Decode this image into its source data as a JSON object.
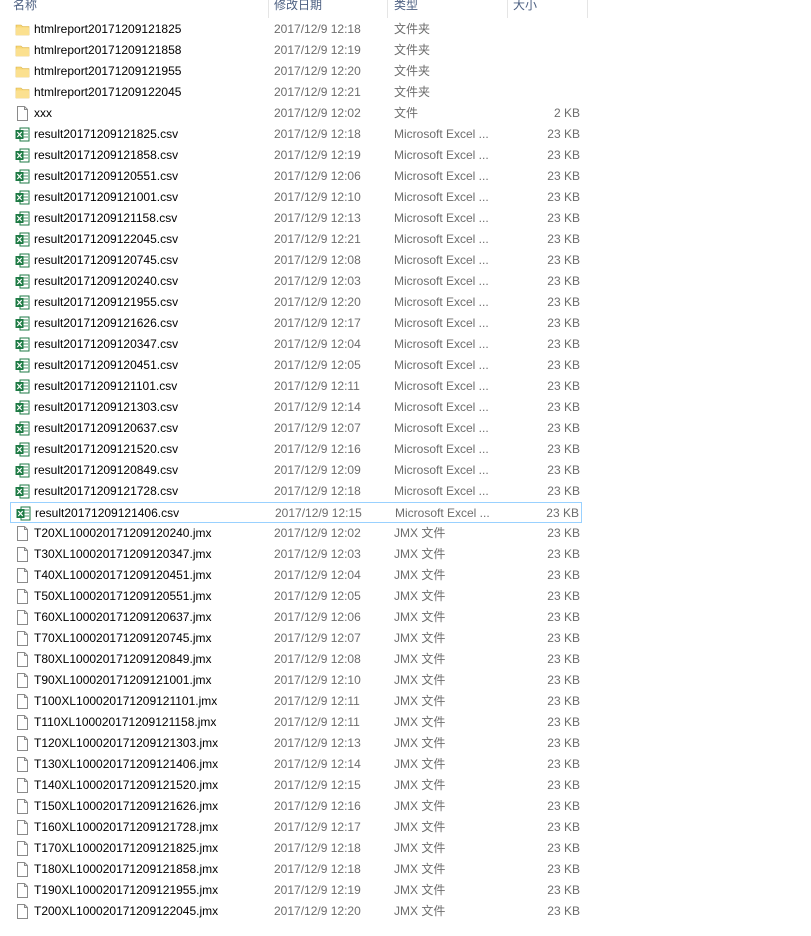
{
  "columns": {
    "name": "名称",
    "date": "修改日期",
    "type": "类型",
    "size": "大小"
  },
  "icon_colors": {
    "folder": "#f8d775",
    "excel": "#1d7a44",
    "file": "#ffffff"
  },
  "files": [
    {
      "icon": "folder-icon",
      "name": "htmlreport20171209121825",
      "date": "2017/12/9 12:18",
      "type": "文件夹",
      "size": ""
    },
    {
      "icon": "folder-icon",
      "name": "htmlreport20171209121858",
      "date": "2017/12/9 12:19",
      "type": "文件夹",
      "size": ""
    },
    {
      "icon": "folder-icon",
      "name": "htmlreport20171209121955",
      "date": "2017/12/9 12:20",
      "type": "文件夹",
      "size": ""
    },
    {
      "icon": "folder-icon",
      "name": "htmlreport20171209122045",
      "date": "2017/12/9 12:21",
      "type": "文件夹",
      "size": ""
    },
    {
      "icon": "file-icon",
      "name": "xxx",
      "date": "2017/12/9 12:02",
      "type": "文件",
      "size": "2 KB"
    },
    {
      "icon": "excel-icon",
      "name": "result20171209121825.csv",
      "date": "2017/12/9 12:18",
      "type": "Microsoft Excel ...",
      "size": "23 KB"
    },
    {
      "icon": "excel-icon",
      "name": "result20171209121858.csv",
      "date": "2017/12/9 12:19",
      "type": "Microsoft Excel ...",
      "size": "23 KB"
    },
    {
      "icon": "excel-icon",
      "name": "result20171209120551.csv",
      "date": "2017/12/9 12:06",
      "type": "Microsoft Excel ...",
      "size": "23 KB"
    },
    {
      "icon": "excel-icon",
      "name": "result20171209121001.csv",
      "date": "2017/12/9 12:10",
      "type": "Microsoft Excel ...",
      "size": "23 KB"
    },
    {
      "icon": "excel-icon",
      "name": "result20171209121158.csv",
      "date": "2017/12/9 12:13",
      "type": "Microsoft Excel ...",
      "size": "23 KB"
    },
    {
      "icon": "excel-icon",
      "name": "result20171209122045.csv",
      "date": "2017/12/9 12:21",
      "type": "Microsoft Excel ...",
      "size": "23 KB"
    },
    {
      "icon": "excel-icon",
      "name": "result20171209120745.csv",
      "date": "2017/12/9 12:08",
      "type": "Microsoft Excel ...",
      "size": "23 KB"
    },
    {
      "icon": "excel-icon",
      "name": "result20171209120240.csv",
      "date": "2017/12/9 12:03",
      "type": "Microsoft Excel ...",
      "size": "23 KB"
    },
    {
      "icon": "excel-icon",
      "name": "result20171209121955.csv",
      "date": "2017/12/9 12:20",
      "type": "Microsoft Excel ...",
      "size": "23 KB"
    },
    {
      "icon": "excel-icon",
      "name": "result20171209121626.csv",
      "date": "2017/12/9 12:17",
      "type": "Microsoft Excel ...",
      "size": "23 KB"
    },
    {
      "icon": "excel-icon",
      "name": "result20171209120347.csv",
      "date": "2017/12/9 12:04",
      "type": "Microsoft Excel ...",
      "size": "23 KB"
    },
    {
      "icon": "excel-icon",
      "name": "result20171209120451.csv",
      "date": "2017/12/9 12:05",
      "type": "Microsoft Excel ...",
      "size": "23 KB"
    },
    {
      "icon": "excel-icon",
      "name": "result20171209121101.csv",
      "date": "2017/12/9 12:11",
      "type": "Microsoft Excel ...",
      "size": "23 KB"
    },
    {
      "icon": "excel-icon",
      "name": "result20171209121303.csv",
      "date": "2017/12/9 12:14",
      "type": "Microsoft Excel ...",
      "size": "23 KB"
    },
    {
      "icon": "excel-icon",
      "name": "result20171209120637.csv",
      "date": "2017/12/9 12:07",
      "type": "Microsoft Excel ...",
      "size": "23 KB"
    },
    {
      "icon": "excel-icon",
      "name": "result20171209121520.csv",
      "date": "2017/12/9 12:16",
      "type": "Microsoft Excel ...",
      "size": "23 KB"
    },
    {
      "icon": "excel-icon",
      "name": "result20171209120849.csv",
      "date": "2017/12/9 12:09",
      "type": "Microsoft Excel ...",
      "size": "23 KB"
    },
    {
      "icon": "excel-icon",
      "name": "result20171209121728.csv",
      "date": "2017/12/9 12:18",
      "type": "Microsoft Excel ...",
      "size": "23 KB"
    },
    {
      "icon": "excel-icon",
      "name": "result20171209121406.csv",
      "date": "2017/12/9 12:15",
      "type": "Microsoft Excel ...",
      "size": "23 KB",
      "selected": true
    },
    {
      "icon": "file-icon",
      "name": "T20XL10002017120912 0240.jmx",
      "date": "2017/12/9 12:02",
      "type": "JMX 文件",
      "size": "23 KB"
    },
    {
      "icon": "file-icon",
      "name": "T30XL100020171209120347.jmx",
      "date": "2017/12/9 12:03",
      "type": "JMX 文件",
      "size": "23 KB"
    },
    {
      "icon": "file-icon",
      "name": "T40XL100020171209120451.jmx",
      "date": "2017/12/9 12:04",
      "type": "JMX 文件",
      "size": "23 KB"
    },
    {
      "icon": "file-icon",
      "name": "T50XL100020171209120551.jmx",
      "date": "2017/12/9 12:05",
      "type": "JMX 文件",
      "size": "23 KB"
    },
    {
      "icon": "file-icon",
      "name": "T60XL100020171209120637.jmx",
      "date": "2017/12/9 12:06",
      "type": "JMX 文件",
      "size": "23 KB"
    },
    {
      "icon": "file-icon",
      "name": "T70XL100020171209120745.jmx",
      "date": "2017/12/9 12:07",
      "type": "JMX 文件",
      "size": "23 KB"
    },
    {
      "icon": "file-icon",
      "name": "T80XL100020171209120849.jmx",
      "date": "2017/12/9 12:08",
      "type": "JMX 文件",
      "size": "23 KB"
    },
    {
      "icon": "file-icon",
      "name": "T90XL100020171209121001.jmx",
      "date": "2017/12/9 12:10",
      "type": "JMX 文件",
      "size": "23 KB"
    },
    {
      "icon": "file-icon",
      "name": "T100XL100020171209121101.jmx",
      "date": "2017/12/9 12:11",
      "type": "JMX 文件",
      "size": "23 KB"
    },
    {
      "icon": "file-icon",
      "name": "T110XL100020171209121158.jmx",
      "date": "2017/12/9 12:11",
      "type": "JMX 文件",
      "size": "23 KB"
    },
    {
      "icon": "file-icon",
      "name": "T120XL100020171209121303.jmx",
      "date": "2017/12/9 12:13",
      "type": "JMX 文件",
      "size": "23 KB"
    },
    {
      "icon": "file-icon",
      "name": "T130XL100020171209121406.jmx",
      "date": "2017/12/9 12:14",
      "type": "JMX 文件",
      "size": "23 KB"
    },
    {
      "icon": "file-icon",
      "name": "T140XL100020171209121520.jmx",
      "date": "2017/12/9 12:15",
      "type": "JMX 文件",
      "size": "23 KB"
    },
    {
      "icon": "file-icon",
      "name": "T150XL100020171209121626.jmx",
      "date": "2017/12/9 12:16",
      "type": "JMX 文件",
      "size": "23 KB"
    },
    {
      "icon": "file-icon",
      "name": "T160XL100020171209121728.jmx",
      "date": "2017/12/9 12:17",
      "type": "JMX 文件",
      "size": "23 KB"
    },
    {
      "icon": "file-icon",
      "name": "T170XL100020171209121825.jmx",
      "date": "2017/12/9 12:18",
      "type": "JMX 文件",
      "size": "23 KB"
    },
    {
      "icon": "file-icon",
      "name": "T180XL100020171209121858.jmx",
      "date": "2017/12/9 12:18",
      "type": "JMX 文件",
      "size": "23 KB"
    },
    {
      "icon": "file-icon",
      "name": "T190XL100020171209121955.jmx",
      "date": "2017/12/9 12:19",
      "type": "JMX 文件",
      "size": "23 KB"
    },
    {
      "icon": "file-icon",
      "name": "T200XL100020171209122045.jmx",
      "date": "2017/12/9 12:20",
      "type": "JMX 文件",
      "size": "23 KB"
    }
  ]
}
